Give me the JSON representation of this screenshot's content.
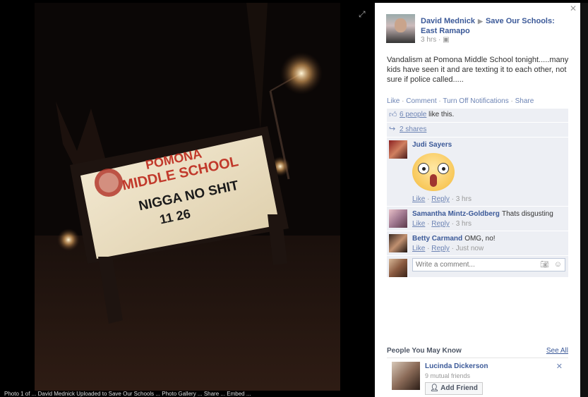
{
  "photo": {
    "sign_line1": "POMONA",
    "sign_line2": "MIDDLE SCHOOL",
    "sign_line3": "NIGGA NO SHIT",
    "sign_line4": "11 26"
  },
  "post": {
    "author": "David Mednick",
    "group": "Save Our Schools: East Ramapo",
    "time": "3 hrs",
    "text": "Vandalism at Pomona Middle School tonight.....many kids have seen it and are texting it to each other, not sure if police called.....",
    "actions": {
      "like": "Like",
      "comment": "Comment",
      "notifications": "Turn Off Notifications",
      "share": "Share"
    },
    "likes": {
      "count_link": "6 people",
      "suffix": " like this."
    },
    "shares": "2 shares"
  },
  "comments": [
    {
      "name": "Judi Sayers",
      "text": "",
      "like": "Like",
      "reply": "Reply",
      "time": "3 hrs"
    },
    {
      "name": "Samantha Mintz-Goldberg",
      "text": "Thats disgusting",
      "like": "Like",
      "reply": "Reply",
      "time": "3 hrs"
    },
    {
      "name": "Betty Carmand",
      "text": "OMG, no!",
      "like": "Like",
      "reply": "Reply",
      "time": "Just now"
    }
  ],
  "write_comment": {
    "placeholder": "Write a comment..."
  },
  "pymk": {
    "title": "People You May Know",
    "see_all": "See All",
    "person": {
      "name": "Lucinda Dickerson",
      "mutual": "9 mutual friends",
      "add_label": "Add Friend"
    }
  },
  "caption": "Photo 1 of ... David Mednick Uploaded to Save Our Schools ... Photo Gallery ... Share ... Embed ...",
  "colors": {
    "link": "#3b5998",
    "ufi_bg": "#edeff4",
    "stage_bg": "#000000"
  }
}
